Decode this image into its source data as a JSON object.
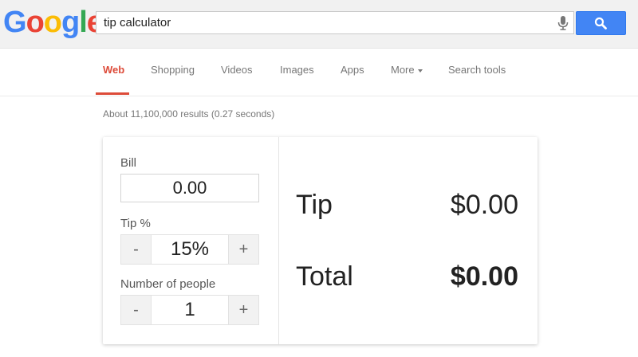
{
  "header": {
    "logo_letters": [
      {
        "char": "G",
        "color": "#4285f4"
      },
      {
        "char": "o",
        "color": "#ea4335"
      },
      {
        "char": "o",
        "color": "#fbbc05"
      },
      {
        "char": "g",
        "color": "#4285f4"
      },
      {
        "char": "l",
        "color": "#34a853"
      },
      {
        "char": "e",
        "color": "#ea4335"
      }
    ],
    "search_query": "tip calculator",
    "mic_icon": "microphone-icon",
    "search_icon": "magnifier-icon",
    "search_button_color": "#4285f4"
  },
  "nav": {
    "tabs": [
      {
        "label": "Web",
        "active": true
      },
      {
        "label": "Shopping",
        "active": false
      },
      {
        "label": "Videos",
        "active": false
      },
      {
        "label": "Images",
        "active": false
      },
      {
        "label": "Apps",
        "active": false
      },
      {
        "label": "More",
        "active": false,
        "has_caret": true
      },
      {
        "label": "Search tools",
        "active": false
      }
    ],
    "active_color": "#dd4b39"
  },
  "result_stats": "About 11,100,000 results (0.27 seconds)",
  "calculator": {
    "bill_label": "Bill",
    "bill_value": "0.00",
    "tip_percent_label": "Tip %",
    "tip_percent_value": "15%",
    "people_label": "Number of people",
    "people_value": "1",
    "minus_label": "-",
    "plus_label": "+",
    "tip_label": "Tip",
    "tip_amount": "$0.00",
    "total_label": "Total",
    "total_amount": "$0.00"
  }
}
